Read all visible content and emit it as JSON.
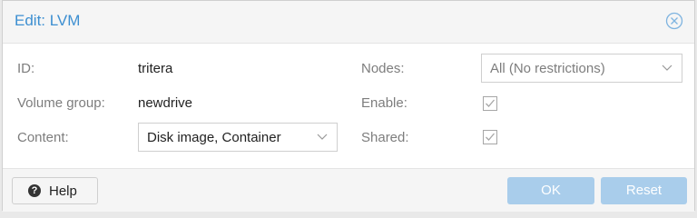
{
  "dialog": {
    "title": "Edit: LVM",
    "close_icon": "close-circle-icon"
  },
  "form": {
    "id_label": "ID:",
    "id_value": "tritera",
    "volume_group_label": "Volume group:",
    "volume_group_value": "newdrive",
    "content_label": "Content:",
    "content_value": "Disk image, Container",
    "nodes_label": "Nodes:",
    "nodes_value": "All (No restrictions)",
    "enable_label": "Enable:",
    "enable_checked": true,
    "shared_label": "Shared:",
    "shared_checked": true
  },
  "footer": {
    "help_label": "Help",
    "ok_label": "OK",
    "reset_label": "Reset"
  },
  "colors": {
    "accent": "#3d8fd1",
    "disabled_button": "#a9cdeb"
  }
}
